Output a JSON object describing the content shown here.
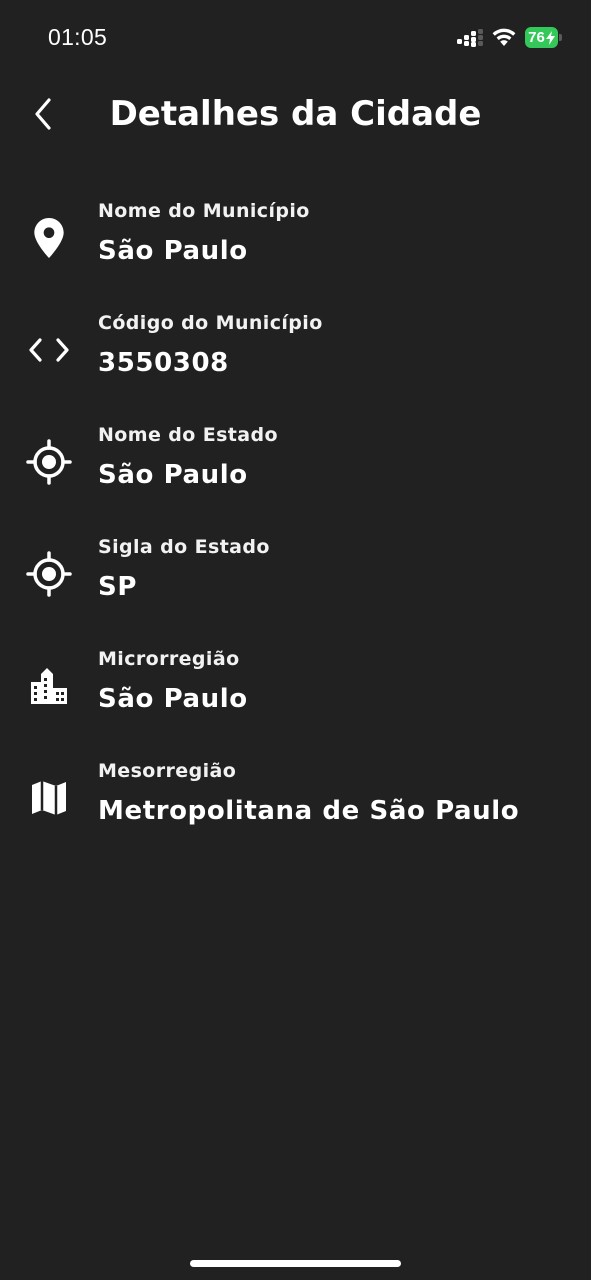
{
  "status_bar": {
    "time": "01:05",
    "battery_level": "76",
    "battery_color": "#34c759",
    "icons": [
      "signal-icon",
      "wifi-icon",
      "battery-charging-icon"
    ]
  },
  "header": {
    "back_icon": "chevron-left-icon",
    "title": "Detalhes da Cidade"
  },
  "details": [
    {
      "icon": "location-pin-icon",
      "label": "Nome do Município",
      "value": "São Paulo"
    },
    {
      "icon": "code-brackets-icon",
      "label": "Código do Município",
      "value": "3550308"
    },
    {
      "icon": "crosshair-icon",
      "label": "Nome do Estado",
      "value": "São Paulo"
    },
    {
      "icon": "crosshair-icon",
      "label": "Sigla do Estado",
      "value": "SP"
    },
    {
      "icon": "buildings-icon",
      "label": "Microrregião",
      "value": "São Paulo"
    },
    {
      "icon": "map-icon",
      "label": "Mesorregião",
      "value": "Metropolitana de São Paulo"
    }
  ],
  "colors": {
    "background": "#212121",
    "text": "#ffffff"
  }
}
